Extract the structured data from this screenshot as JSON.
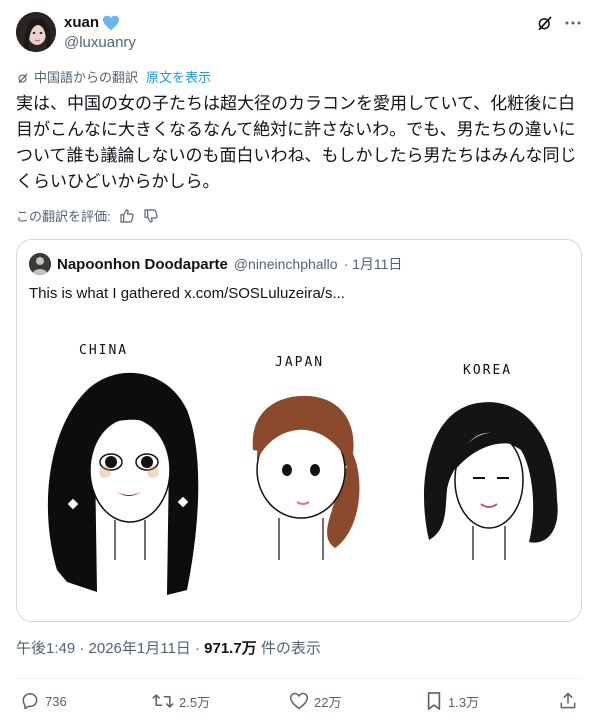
{
  "author": {
    "name": "xuan",
    "handle": "@luxuanry"
  },
  "translation": {
    "note": "中国語からの翻訳",
    "show_original": "原文を表示"
  },
  "tweet_text": "実は、中国の女の子たちは超大径のカラコンを愛用していて、化粧後に白目がこんなに大きくなるなんて絶対に許さないわ。でも、男たちの違いについて誰も議論しないのも面白いわね、もしかしたら男たちはみんな同じくらいひどいからかしら。",
  "rate": {
    "label": "この翻訳を評価:"
  },
  "quote": {
    "name": "Napoonhon Doodaparte",
    "handle": "@nineinchphallo",
    "date": "· 1月11日",
    "text": "This is what I gathered  x.com/SOSLuluzeira/s...",
    "image_labels": {
      "china": "CHINA",
      "japan": "JAPAN",
      "korea": "KOREA"
    }
  },
  "meta": {
    "time": "午後1:49 · 2026年1月11日 · ",
    "views": "971.7万",
    "views_suffix": " 件の表示"
  },
  "actions": {
    "replies": "736",
    "reposts": "2.5万",
    "likes": "22万",
    "bookmarks": "1.3万"
  },
  "colors": {
    "accent": "#1d9bf0",
    "verified": "#66b5f5",
    "muted": "#536471"
  }
}
